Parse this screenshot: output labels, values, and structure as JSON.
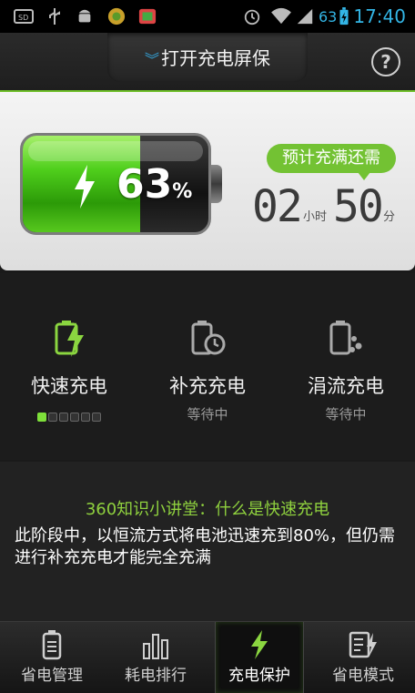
{
  "status_bar": {
    "battery_percent": "63",
    "time": "17:40",
    "icons": [
      "sd-card-icon",
      "usb-icon",
      "android-debug-icon",
      "app-icon",
      "gallery-icon",
      "alarm-icon",
      "wifi-icon",
      "signal-icon",
      "battery-charging-icon"
    ]
  },
  "header": {
    "title": "打开充电屏保",
    "help_icon": "question-icon"
  },
  "battery": {
    "percent": 63,
    "percent_label": "63",
    "percent_sign": "%",
    "estimate_label": "预计充满还需",
    "hours": "02",
    "hours_unit": "小时",
    "minutes": "50",
    "minutes_unit": "分"
  },
  "modes": [
    {
      "title": "快速充电",
      "status": "",
      "icon": "fast-charge-icon",
      "active": true
    },
    {
      "title": "补充充电",
      "status": "等待中",
      "icon": "supplement-charge-icon",
      "active": false
    },
    {
      "title": "涓流充电",
      "status": "等待中",
      "icon": "trickle-charge-icon",
      "active": false
    }
  ],
  "fast_progress": {
    "active_steps": 1,
    "total_steps": 6
  },
  "knowledge": {
    "title": "360知识小讲堂：什么是快速充电",
    "body": "此阶段中，以恒流方式将电池迅速充到80%，但仍需进行补充充电才能完全充满"
  },
  "nav": [
    {
      "label": "省电管理",
      "icon": "battery-manage-icon",
      "active": false
    },
    {
      "label": "耗电排行",
      "icon": "bar-chart-icon",
      "active": false
    },
    {
      "label": "充电保护",
      "icon": "lightning-icon",
      "active": true
    },
    {
      "label": "省电模式",
      "icon": "list-bolt-icon",
      "active": false
    }
  ],
  "colors": {
    "accent_green": "#73c233",
    "status_blue": "#33b5e5"
  }
}
